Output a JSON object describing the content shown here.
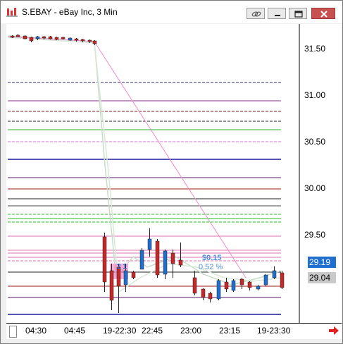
{
  "window": {
    "title": "S.EBAY - eBay Inc, 3 Min"
  },
  "price_axis": {
    "labels": [
      "31.50",
      "31.00",
      "30.50",
      "30.00",
      "29.50"
    ],
    "last_price": "29.19",
    "current_price": "29.04"
  },
  "time_axis": {
    "labels": [
      "04:30",
      "04:45",
      "19-22:30",
      "22:45",
      "23:00",
      "23:15",
      "19-23:30"
    ]
  },
  "annotation": {
    "change": "$0.15",
    "percent": "0.52 %",
    "box_label": "2 1"
  },
  "colors": {
    "up_candle": "#1f6fd1",
    "down_candle": "#c62828",
    "ma_line": "#c8dcc8",
    "trend_line": "#f08cc8"
  },
  "icons": [
    "chart-icon",
    "link-icon",
    "minimize-icon",
    "maximize-icon",
    "close-icon",
    "scroll-right-icon"
  ]
}
